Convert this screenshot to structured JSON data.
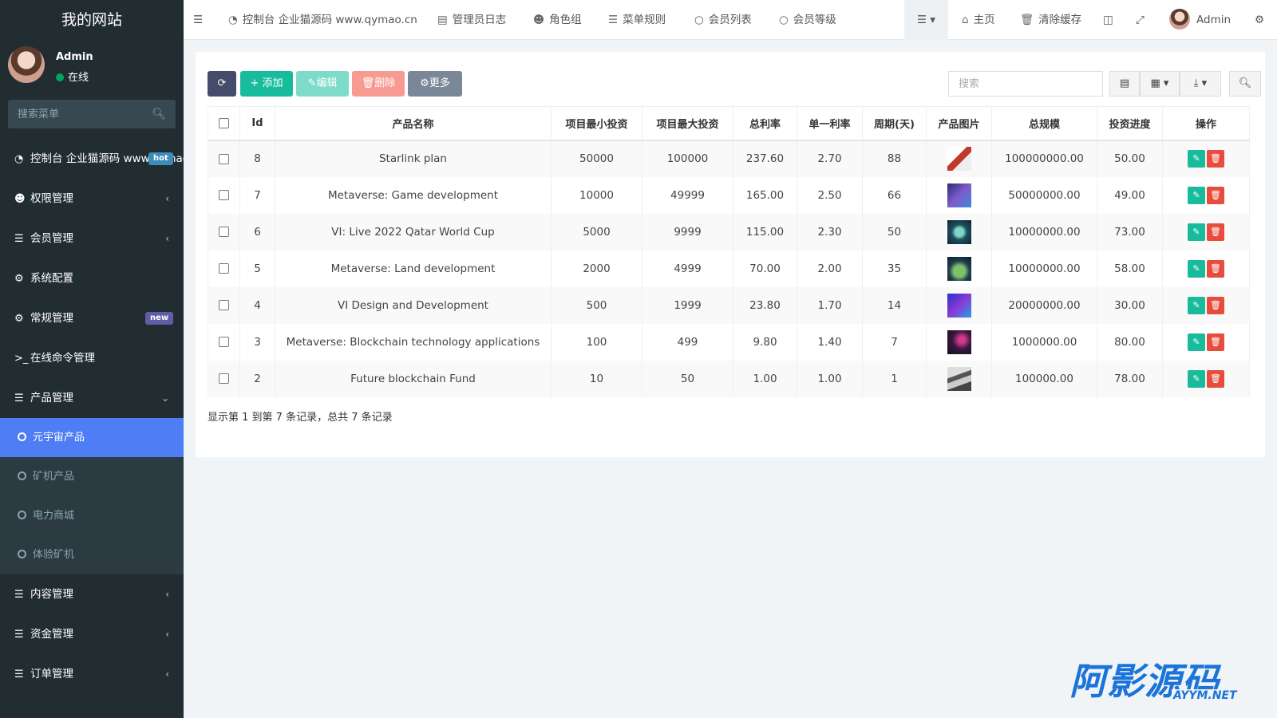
{
  "sidebar": {
    "brand": "我的网站",
    "user": {
      "name": "Admin",
      "status": "在线"
    },
    "search_placeholder": "搜索菜单",
    "items": [
      {
        "label": "控制台 企业猫源码 www.qymao.cn",
        "badge": "hot",
        "icon": "dashboard-icon"
      },
      {
        "label": "权限管理",
        "icon": "users-icon"
      },
      {
        "label": "会员管理",
        "icon": "list-icon"
      },
      {
        "label": "系统配置",
        "icon": "gear-icon"
      },
      {
        "label": "常规管理",
        "badge": "new",
        "icon": "gears-icon"
      },
      {
        "label": "在线命令管理",
        "icon": "terminal-icon"
      },
      {
        "label": "产品管理",
        "icon": "list-icon"
      }
    ],
    "sub_items": [
      {
        "label": "元宇宙产品",
        "active": true
      },
      {
        "label": "矿机产品"
      },
      {
        "label": "电力商城"
      },
      {
        "label": "体验矿机"
      }
    ],
    "bottom_items": [
      {
        "label": "内容管理"
      },
      {
        "label": "资金管理"
      },
      {
        "label": "订单管理"
      }
    ]
  },
  "topnav": {
    "tabs": [
      "控制台 企业猫源码 www.qymao.cn",
      "管理员日志",
      "角色组",
      "菜单规则",
      "会员列表",
      "会员等级"
    ],
    "home": "主页",
    "clear_cache": "清除缓存",
    "admin": "Admin"
  },
  "toolbar": {
    "add": "添加",
    "edit": "编辑",
    "delete": "删除",
    "more": "更多",
    "search_placeholder": "搜索"
  },
  "table": {
    "columns": [
      "Id",
      "产品名称",
      "项目最小投资",
      "项目最大投资",
      "总利率",
      "单一利率",
      "周期(天)",
      "产品图片",
      "总规模",
      "投资进度",
      "操作"
    ],
    "rows": [
      [
        "8",
        "Starlink plan",
        "50000",
        "100000",
        "237.60",
        "2.70",
        "88",
        "100000000.00",
        "50.00"
      ],
      [
        "7",
        "Metaverse: Game development",
        "10000",
        "49999",
        "165.00",
        "2.50",
        "66",
        "50000000.00",
        "49.00"
      ],
      [
        "6",
        "VI: Live 2022 Qatar World Cup",
        "5000",
        "9999",
        "115.00",
        "2.30",
        "50",
        "10000000.00",
        "73.00"
      ],
      [
        "5",
        "Metaverse: Land development",
        "2000",
        "4999",
        "70.00",
        "2.00",
        "35",
        "10000000.00",
        "58.00"
      ],
      [
        "4",
        "VI Design and Development",
        "500",
        "1999",
        "23.80",
        "1.70",
        "14",
        "20000000.00",
        "30.00"
      ],
      [
        "3",
        "Metaverse: Blockchain technology applications",
        "100",
        "499",
        "9.80",
        "1.40",
        "7",
        "1000000.00",
        "80.00"
      ],
      [
        "2",
        "Future blockchain Fund",
        "10",
        "50",
        "1.00",
        "1.00",
        "1",
        "100000.00",
        "78.00"
      ]
    ],
    "pager_text": "显示第 1 到第 7 条记录，总共 7 条记录"
  },
  "watermark": {
    "main": "阿影源码",
    "sub": "AYYM.NET"
  },
  "colors": {
    "sidebar_bg": "#222d32",
    "active": "#4e7df5",
    "success": "#18bc9c",
    "danger": "#e74c3c"
  }
}
